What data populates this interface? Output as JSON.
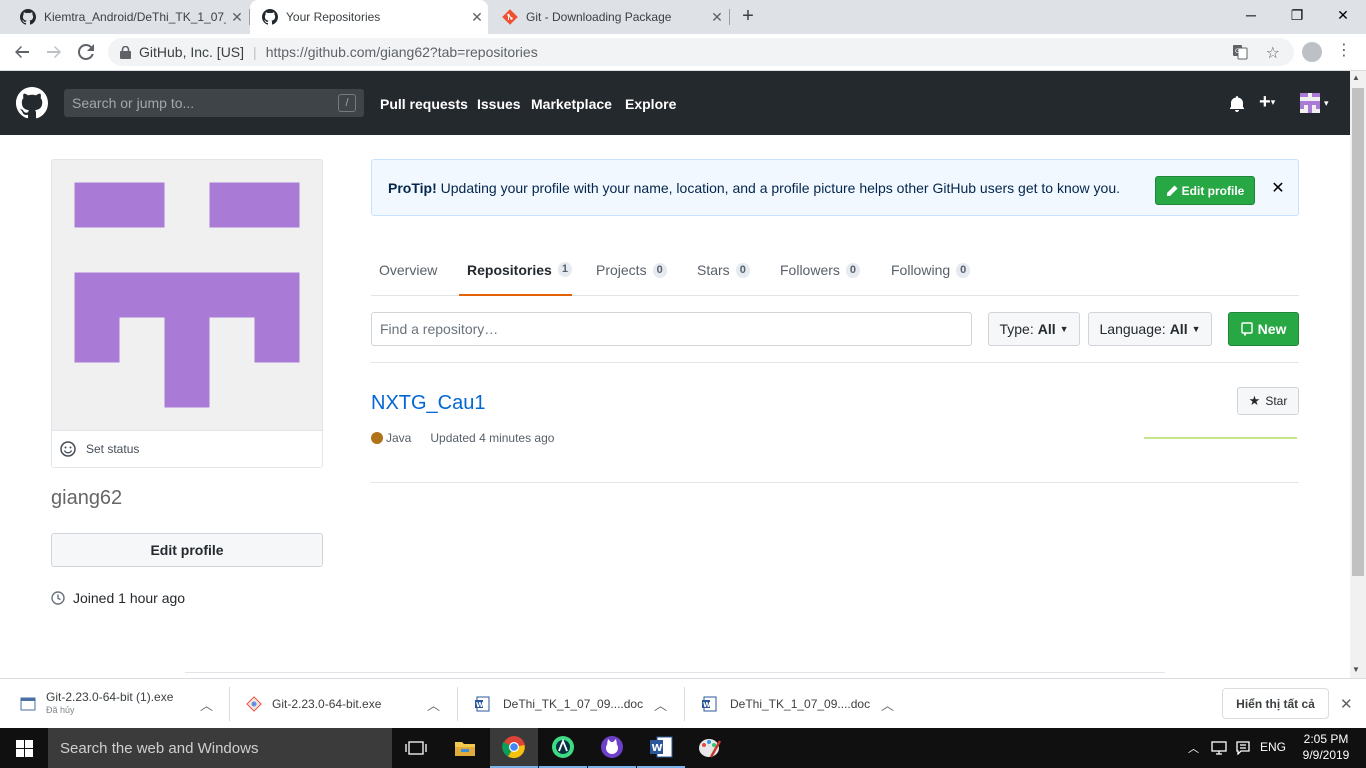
{
  "browser": {
    "tabs": [
      {
        "title": "Kiemtra_Android/DeThi_TK_1_07_",
        "icon": "github-icon"
      },
      {
        "title": "Your Repositories",
        "icon": "github-icon"
      },
      {
        "title": "Git - Downloading Package",
        "icon": "git-icon"
      }
    ],
    "active_tab": 1,
    "new_tab_label": "+",
    "cert_label": "GitHub, Inc. [US]",
    "url": "https://github.com/giang62?tab=repositories"
  },
  "github": {
    "search_placeholder": "Search or jump to...",
    "search_shortcut": "/",
    "nav": [
      "Pull requests",
      "Issues",
      "Marketplace",
      "Explore"
    ],
    "header_icons": [
      "bell-icon",
      "plus-icon",
      "avatar"
    ]
  },
  "profile": {
    "username": "giang62",
    "set_status": "Set status",
    "edit_profile": "Edit profile",
    "joined": "Joined 1 hour ago",
    "avatar_color": "#a97bd6"
  },
  "protip": {
    "label": "ProTip!",
    "text": "Updating your profile with your name, location, and a profile picture helps other GitHub users get to know you.",
    "button": "Edit profile",
    "close": "✕"
  },
  "tabs": [
    {
      "label": "Overview",
      "count": null
    },
    {
      "label": "Repositories",
      "count": "1"
    },
    {
      "label": "Projects",
      "count": "0"
    },
    {
      "label": "Stars",
      "count": "0"
    },
    {
      "label": "Followers",
      "count": "0"
    },
    {
      "label": "Following",
      "count": "0"
    }
  ],
  "filters": {
    "find_placeholder": "Find a repository…",
    "type_label": "Type:",
    "type_value": "All",
    "language_label": "Language:",
    "language_value": "All",
    "new_button": "New"
  },
  "repos": [
    {
      "name": "NXTG_Cau1",
      "language": "Java",
      "language_color": "#b07219",
      "updated": "Updated 4 minutes ago",
      "star_label": "Star"
    }
  ],
  "downloads": {
    "items": [
      {
        "name": "Git-2.23.0-64-bit (1).exe",
        "status": "Đã hủy"
      },
      {
        "name": "Git-2.23.0-64-bit.exe",
        "status": ""
      },
      {
        "name": "DeThi_TK_1_07_09....doc",
        "status": ""
      },
      {
        "name": "DeThi_TK_1_07_09....doc",
        "status": ""
      }
    ],
    "show_all": "Hiển thị tất cả"
  },
  "taskbar": {
    "search_placeholder": "Search the web and Windows",
    "lang": "ENG",
    "time": "2:05 PM",
    "date": "9/9/2019"
  },
  "colors": {
    "gh_header": "#24292e",
    "green": "#28a745",
    "link": "#0366d6",
    "tab_underline": "#e36209"
  }
}
